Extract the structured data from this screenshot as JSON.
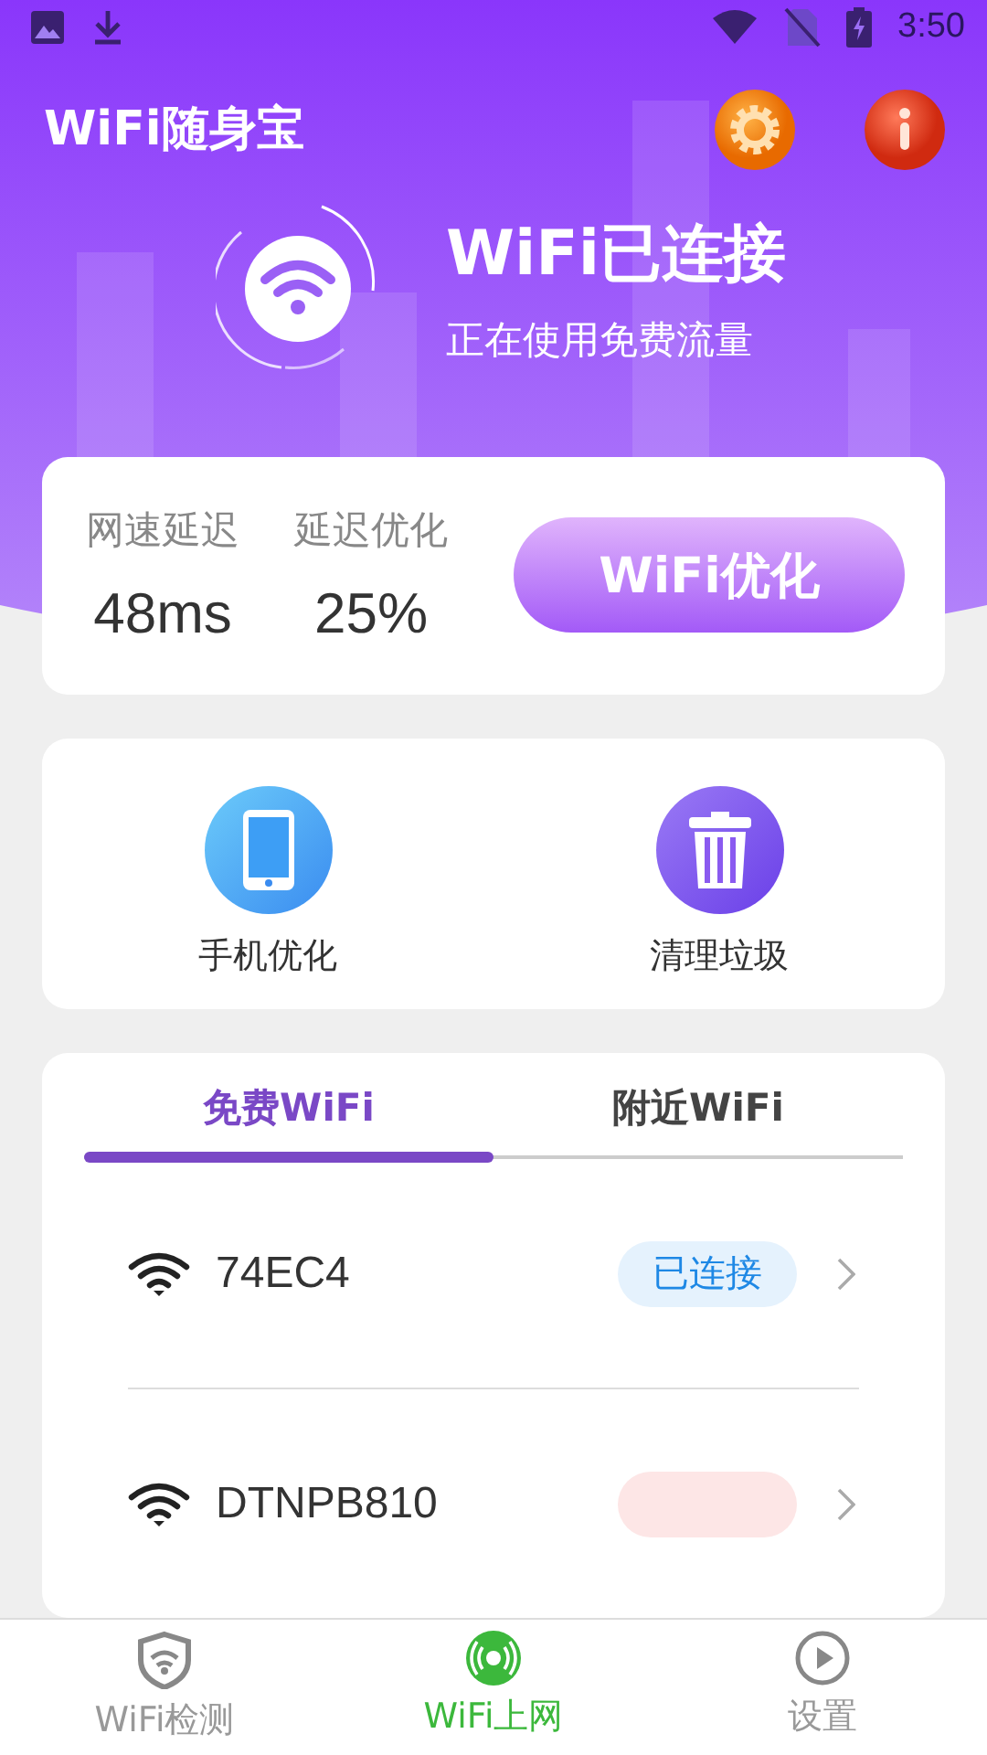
{
  "status_bar": {
    "time": "3:50"
  },
  "app_title": "WiFi随身宝",
  "connection": {
    "title": "WiFi已连接",
    "subtitle": "正在使用免费流量"
  },
  "stats": [
    {
      "label": "网速延迟",
      "value": "48ms"
    },
    {
      "label": "延迟优化",
      "value": "25%"
    }
  ],
  "optimize_button": "WiFi优化",
  "tools": [
    {
      "label": "手机优化",
      "kind": "phone"
    },
    {
      "label": "清理垃圾",
      "kind": "trash"
    }
  ],
  "tabs": [
    {
      "label": "免费WiFi",
      "selected": true
    },
    {
      "label": "附近WiFi",
      "selected": false
    }
  ],
  "networks": [
    {
      "name": "74EC4",
      "status": "已连接",
      "kind": "connected"
    },
    {
      "name": "DTNPB810",
      "kind": "other"
    }
  ],
  "nav": [
    {
      "label": "WiFi检测",
      "kind": "shield",
      "selected": false
    },
    {
      "label": "WiFi上网",
      "kind": "signal",
      "selected": true
    },
    {
      "label": "设置",
      "kind": "play",
      "selected": false
    }
  ]
}
